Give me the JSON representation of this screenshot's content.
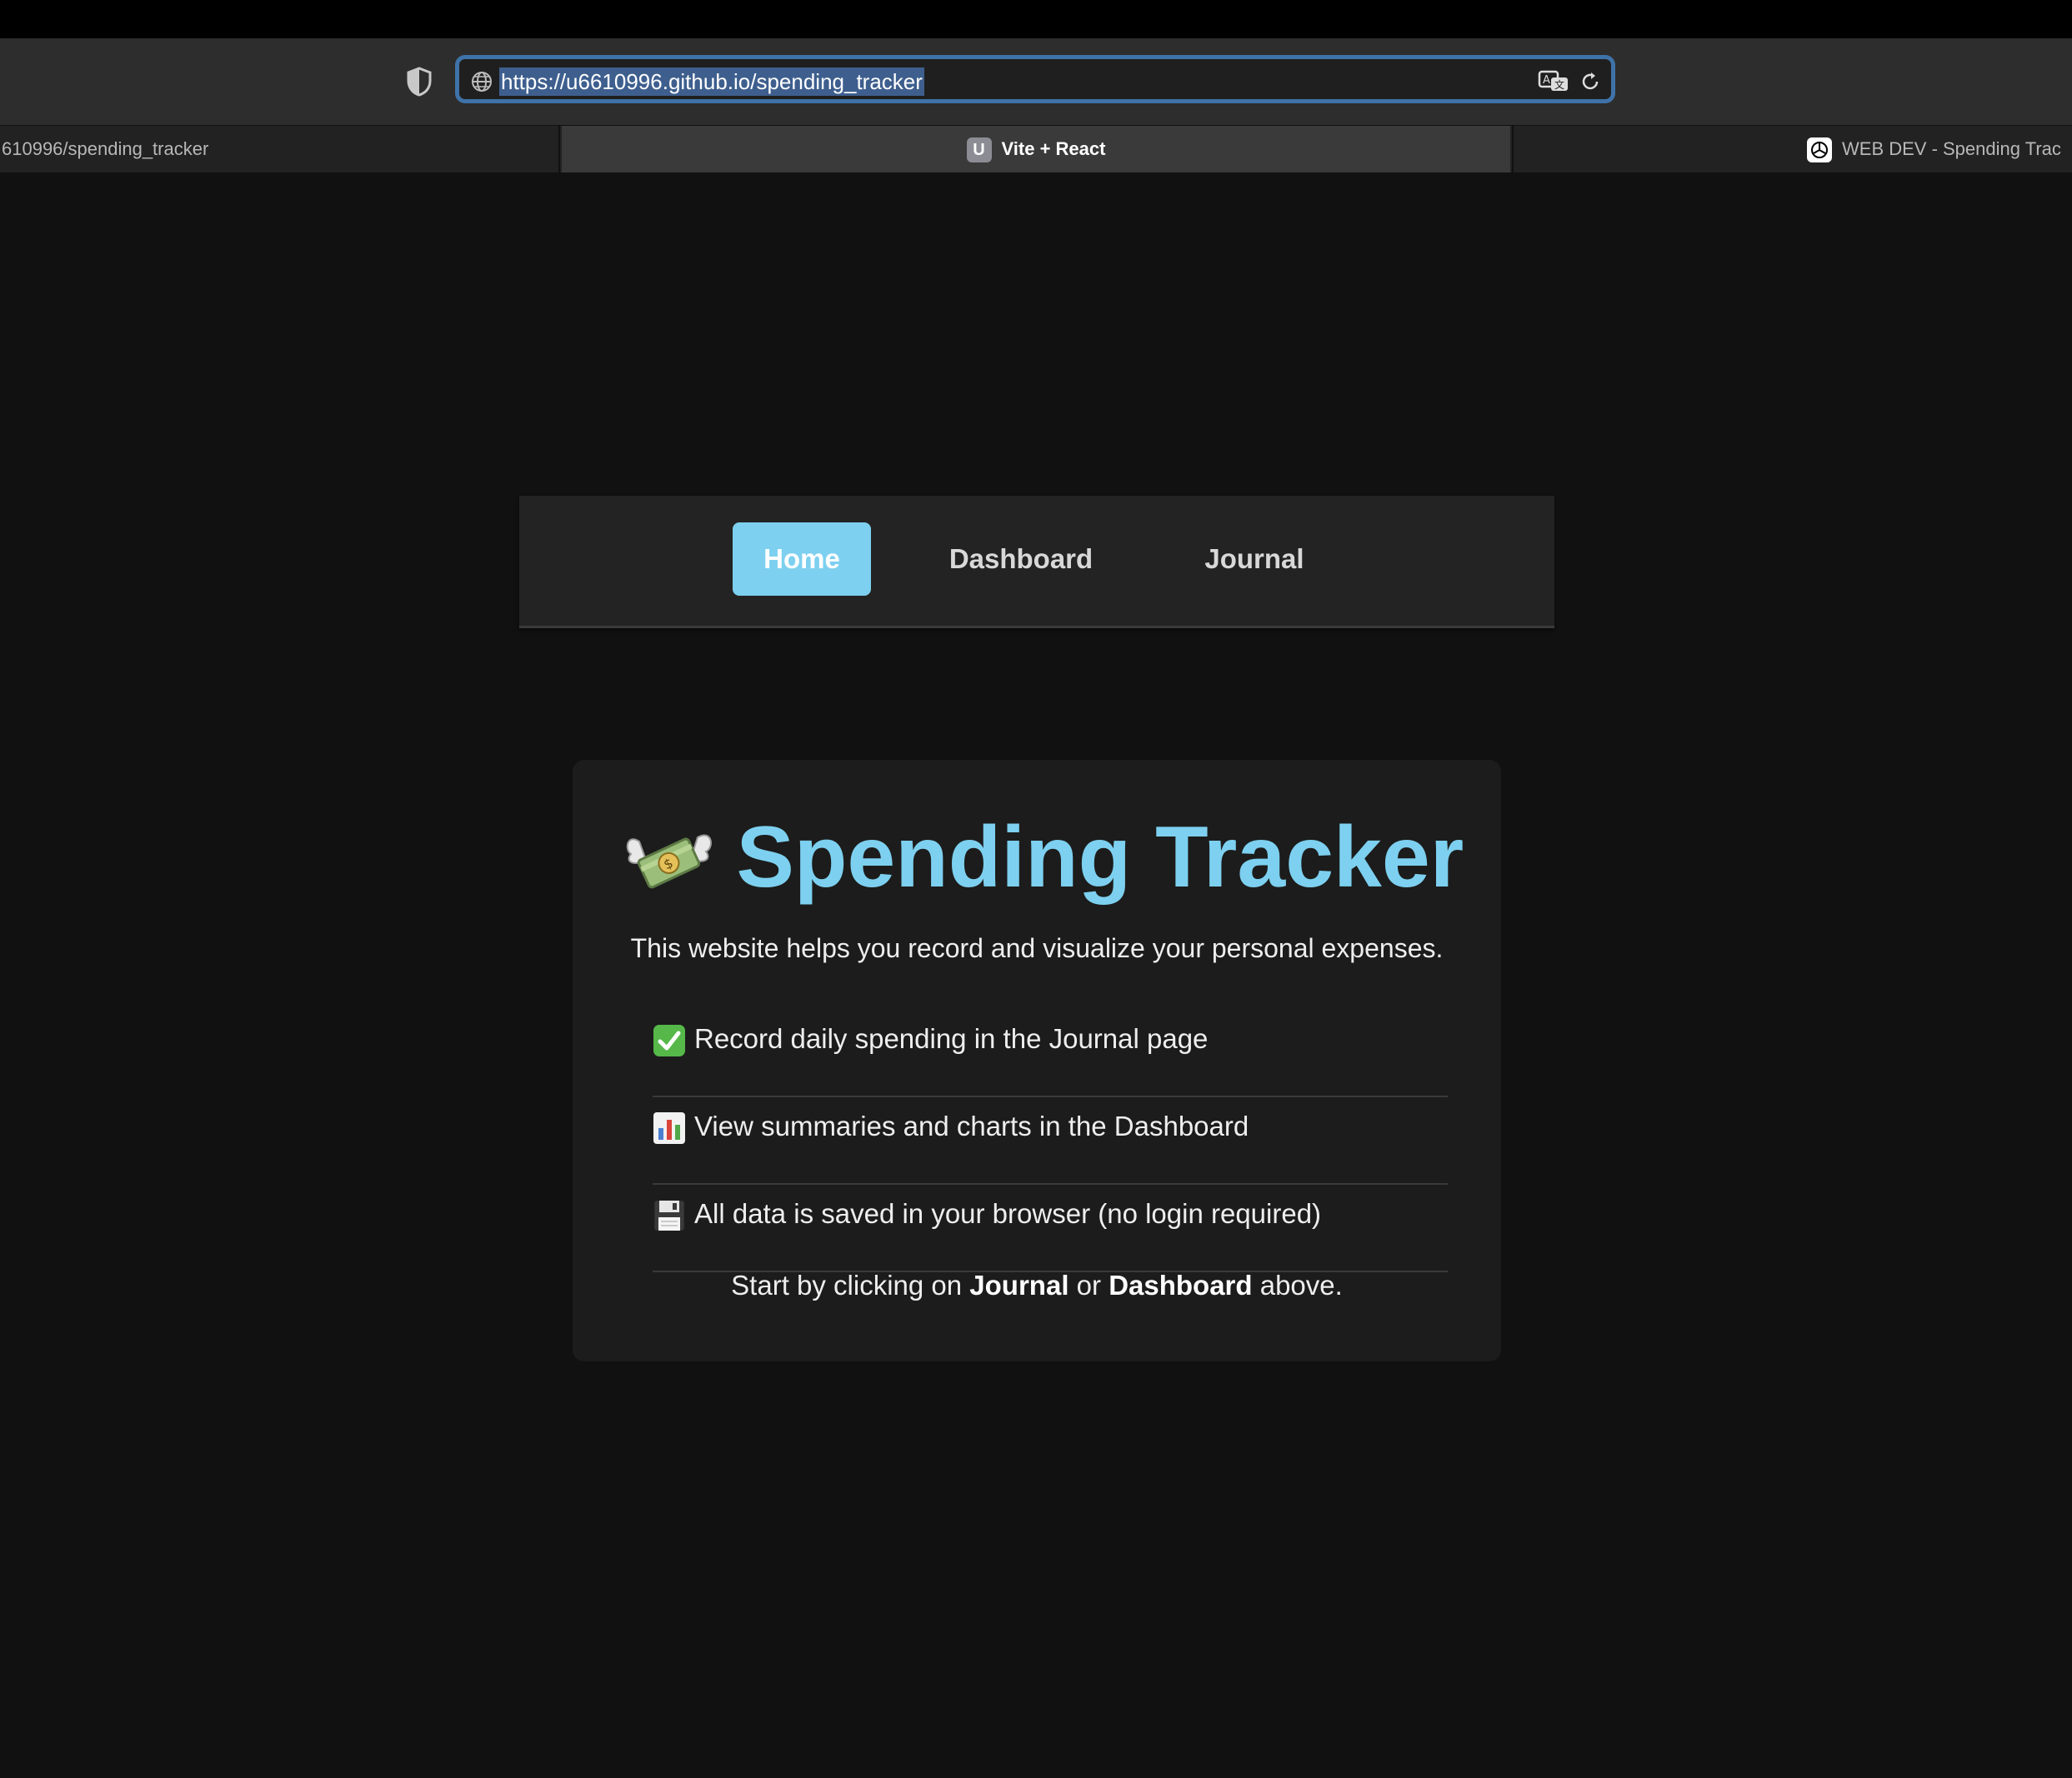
{
  "browser": {
    "url": "https://u6610996.github.io/spending_tracker",
    "tabs": [
      {
        "label": "610996/spending_tracker"
      },
      {
        "label": "Vite + React",
        "favicon_letter": "U"
      },
      {
        "label": "WEB DEV - Spending Trac"
      }
    ]
  },
  "nav": {
    "home": "Home",
    "dashboard": "Dashboard",
    "journal": "Journal",
    "active": "Home"
  },
  "main": {
    "title": "Spending Tracker",
    "title_icon": "money-with-wings-icon",
    "intro": "This website helps you record and visualize your personal expenses.",
    "features": [
      {
        "icon": "check-mark-icon",
        "text": "Record daily spending in the Journal page"
      },
      {
        "icon": "bar-chart-icon",
        "text": "View summaries and charts in the Dashboard"
      },
      {
        "icon": "floppy-disk-icon",
        "text": "All data is saved in your browser (no login required)"
      }
    ],
    "footer": {
      "prefix": "Start by clicking on ",
      "link1": "Journal",
      "middle": " or ",
      "link2": "Dashboard",
      "suffix": " above."
    }
  },
  "colors": {
    "accent": "#7dd0ef",
    "background": "#111111",
    "card": "#1c1c1c",
    "navbar": "#232323"
  }
}
